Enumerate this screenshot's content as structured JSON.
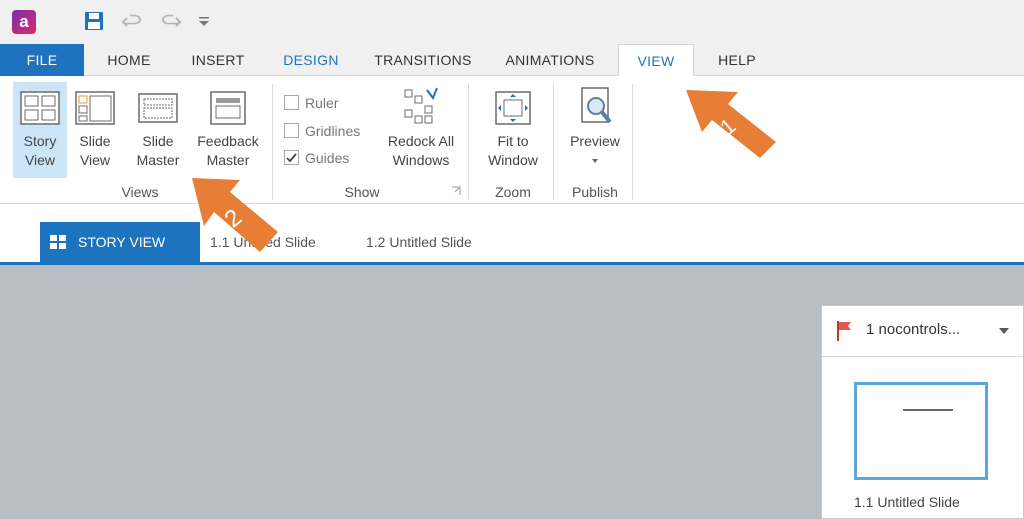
{
  "app": {
    "logo_letter": "a"
  },
  "tabs": [
    {
      "label": "FILE"
    },
    {
      "label": "HOME"
    },
    {
      "label": "INSERT"
    },
    {
      "label": "DESIGN"
    },
    {
      "label": "TRANSITIONS"
    },
    {
      "label": "ANIMATIONS"
    },
    {
      "label": "VIEW"
    },
    {
      "label": "HELP"
    }
  ],
  "ribbon": {
    "views": {
      "group_label": "Views",
      "story_view": [
        "Story",
        "View"
      ],
      "slide_view": [
        "Slide",
        "View"
      ],
      "slide_master": [
        "Slide",
        "Master"
      ],
      "feedback_master": [
        "Feedback",
        "Master"
      ]
    },
    "show": {
      "group_label": "Show",
      "ruler": "Ruler",
      "gridlines": "Gridlines",
      "guides": "Guides",
      "redock": [
        "Redock All",
        "Windows"
      ]
    },
    "zoom": {
      "group_label": "Zoom",
      "fit": [
        "Fit to",
        "Window"
      ]
    },
    "publish": {
      "group_label": "Publish",
      "preview": "Preview"
    }
  },
  "story_tabs": {
    "active": "STORY VIEW",
    "slide1": "1.1 Untitled Slide",
    "slide2": "1.2 Untitled Slide"
  },
  "panel": {
    "scene": "1  nocontrols...",
    "thumb_caption": "1.1 Untitled Slide"
  },
  "callouts": {
    "one": "1",
    "two": "2"
  },
  "colors": {
    "accent": "#1e73be",
    "callout": "#e87d35"
  }
}
